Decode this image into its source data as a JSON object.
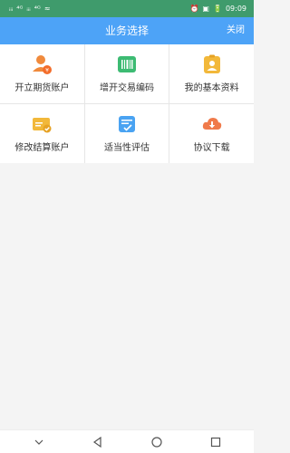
{
  "status": {
    "left": [
      "ᵢᵢᵢ",
      "⁴ᴳ",
      "ᵢᵢᵢ",
      "⁴ᴳ",
      "≈"
    ],
    "right_icons": [
      "⏰",
      "▣",
      "🔋"
    ],
    "time": "09:09"
  },
  "header": {
    "title": "业务选择",
    "close_label": "关闭"
  },
  "menu": {
    "items": [
      {
        "label": "开立期货账户",
        "icon": "open-account-icon",
        "color": "#f08a3c"
      },
      {
        "label": "增开交易编码",
        "icon": "barcode-icon",
        "color": "#3dbb73"
      },
      {
        "label": "我的基本资料",
        "icon": "profile-card-icon",
        "color": "#f2b83a"
      },
      {
        "label": "修改结算账户",
        "icon": "bank-card-icon",
        "color": "#f2b83a"
      },
      {
        "label": "适当性评估",
        "icon": "assessment-icon",
        "color": "#4aa3f2"
      },
      {
        "label": "协议下载",
        "icon": "cloud-download-icon",
        "color": "#f07a4a"
      }
    ]
  },
  "navbar": {
    "icons": [
      "chevron-down-icon",
      "back-triangle-icon",
      "home-circle-icon",
      "recents-square-icon"
    ]
  }
}
